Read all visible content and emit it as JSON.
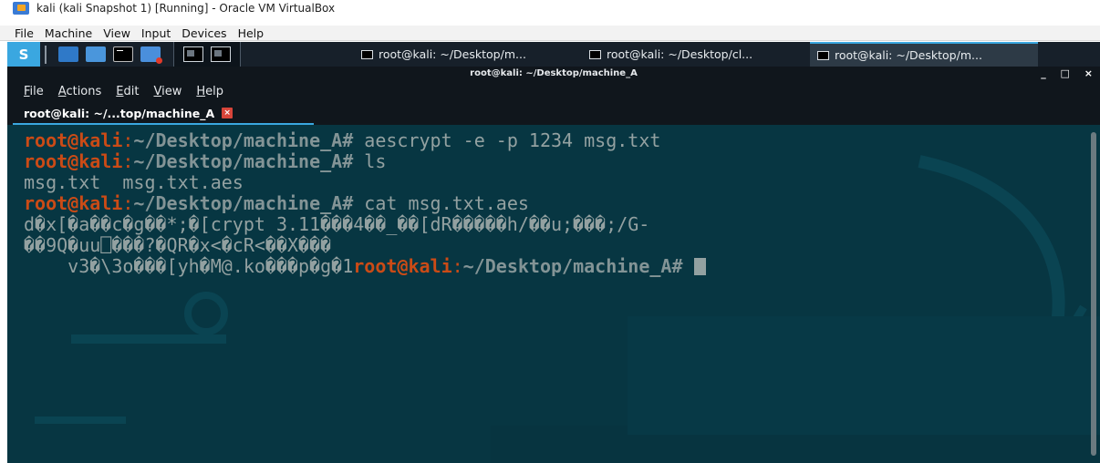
{
  "vbox": {
    "window_title": "kali (kali Snapshot 1) [Running] - Oracle VM VirtualBox",
    "menu": [
      "File",
      "Machine",
      "View",
      "Input",
      "Devices",
      "Help"
    ]
  },
  "panel": {
    "tasks": [
      "root@kali: ~/Desktop/m...",
      "root@kali: ~/Desktop/cl...",
      "root@kali: ~/Desktop/m..."
    ]
  },
  "terminal": {
    "window_title": "root@kali: ~/Desktop/machine_A",
    "menu": [
      "File",
      "Actions",
      "Edit",
      "View",
      "Help"
    ],
    "tab_label": "root@kali: ~/...top/machine_A",
    "prompt": {
      "user_host": "root@kali",
      "colon": ":",
      "path": "~/Desktop/machine_A",
      "symbol": "#"
    },
    "commands": {
      "encrypt": " aescrypt -e -p 1234 msg.txt",
      "list": " ls",
      "cat": " cat msg.txt.aes"
    },
    "output": {
      "ls": "msg.txt  msg.txt.aes",
      "cat_line1": "d�x[�a��c�g��*;�[crypt 3.11���4��_��[dR�����h/��u;���;/G-",
      "cat_line2": "��9Q�uu⎕���?�QR�x<�cR<��X���",
      "cat_line3": "    v3�\\3o���[yh�M@.ko���p�g�1"
    },
    "colors": {
      "background": "#073642",
      "prompt_user": "#cb4b16",
      "prompt_path": "#839496",
      "text": "#93a1a1"
    }
  }
}
